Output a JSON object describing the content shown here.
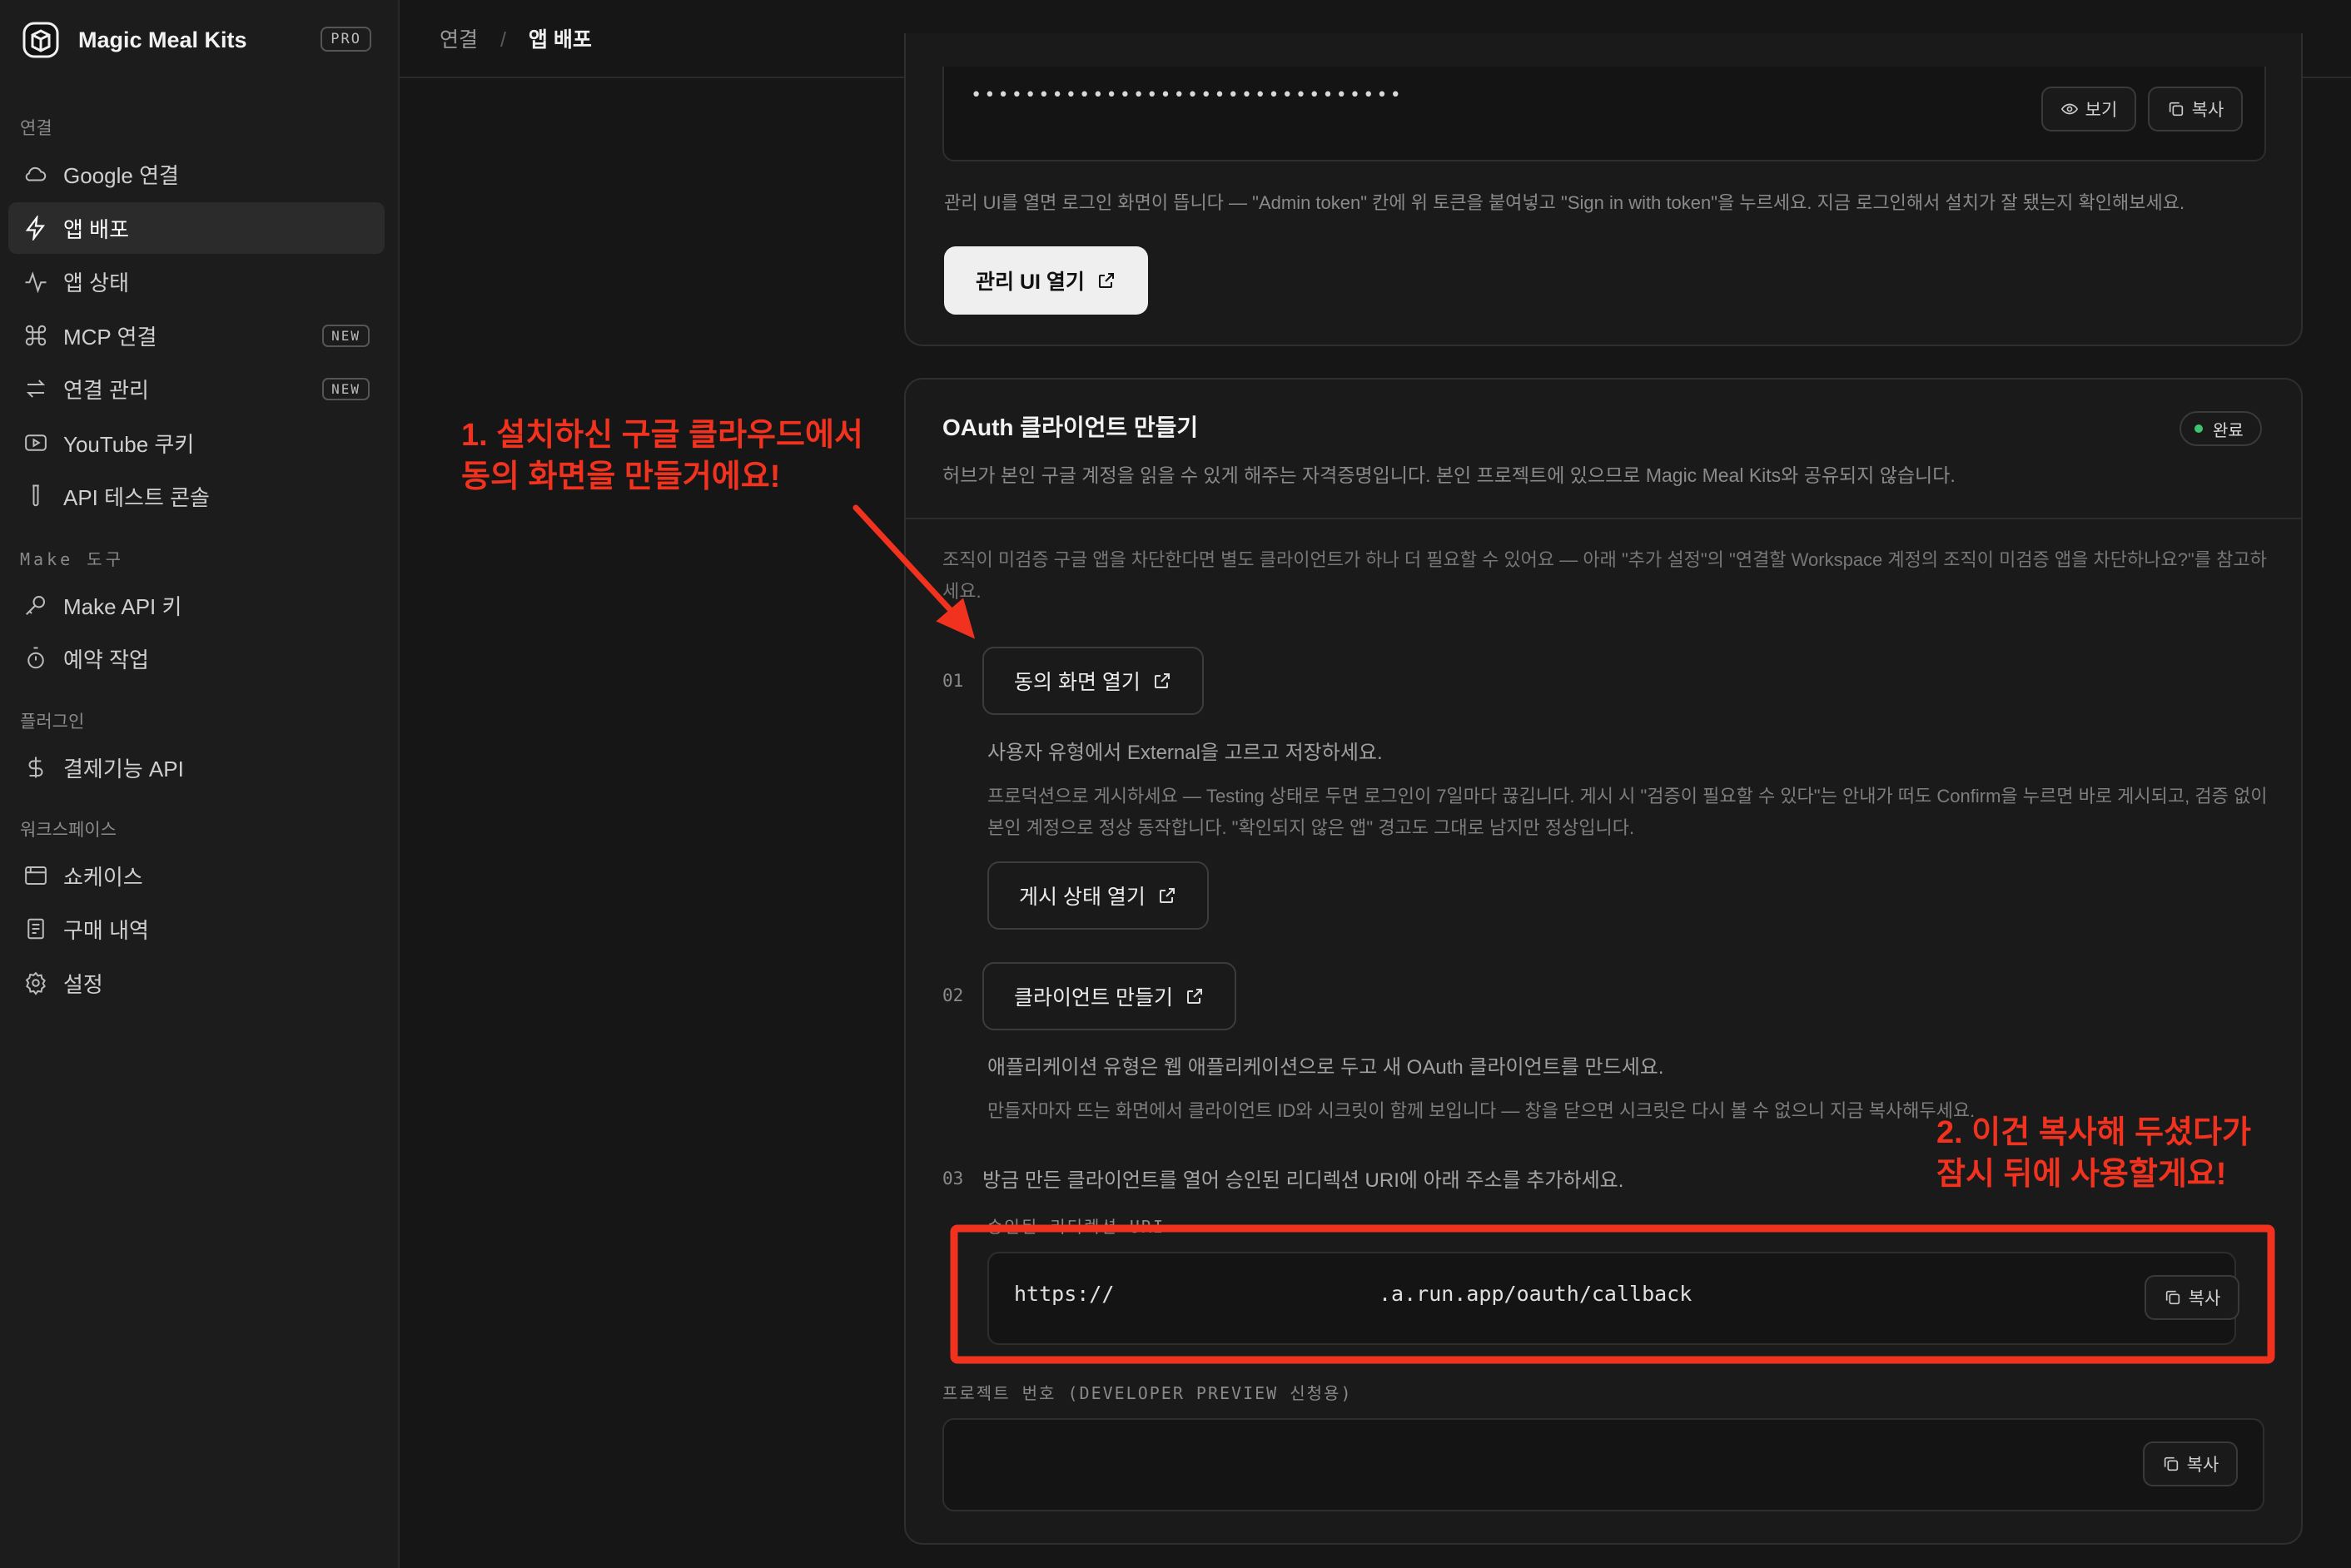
{
  "app": {
    "name": "Magic Meal Kits",
    "plan_badge": "PRO"
  },
  "sidebar": {
    "sections": [
      {
        "title": "연결",
        "items": [
          {
            "label": "Google 연결",
            "icon": "cloud-icon"
          },
          {
            "label": "앱 배포",
            "icon": "bolt-icon",
            "active": true
          },
          {
            "label": "앱 상태",
            "icon": "activity-icon"
          },
          {
            "label": "MCP 연결",
            "icon": "command-icon",
            "tag": "NEW"
          },
          {
            "label": "연결 관리",
            "icon": "swap-icon",
            "tag": "NEW"
          },
          {
            "label": "YouTube 쿠키",
            "icon": "youtube-icon"
          },
          {
            "label": "API 테스트 콘솔",
            "icon": "test-tube-icon"
          }
        ]
      },
      {
        "title": "Make 도구",
        "items": [
          {
            "label": "Make API 키",
            "icon": "key-icon"
          },
          {
            "label": "예약 작업",
            "icon": "timer-icon"
          }
        ]
      },
      {
        "title": "플러그인",
        "items": [
          {
            "label": "결제기능 API",
            "icon": "dollar-icon"
          }
        ]
      },
      {
        "title": "워크스페이스",
        "items": [
          {
            "label": "쇼케이스",
            "icon": "browser-icon"
          },
          {
            "label": "구매 내역",
            "icon": "receipt-icon"
          },
          {
            "label": "설정",
            "icon": "gear-icon"
          }
        ]
      }
    ]
  },
  "breadcrumb": {
    "parent": "연결",
    "separator": "/",
    "current": "앱 배포"
  },
  "admin_card": {
    "token_masked": "••••••••••••••••••••••••••••••••",
    "view_label": "보기",
    "copy_label": "복사",
    "help_text": "관리 UI를 열면 로그인 화면이 뜹니다 — \"Admin token\" 칸에 위 토큰을 붙여넣고 \"Sign in with token\"을 누르세요. 지금 로그인해서 설치가 잘 됐는지 확인해보세요.",
    "open_admin_label": "관리 UI 열기"
  },
  "oauth_card": {
    "title": "OAuth 클라이언트 만들기",
    "status_label": "완료",
    "status_color": "#3ec46d",
    "subtitle": "허브가 본인 구글 계정을 읽을 수 있게 해주는 자격증명입니다. 본인 프로젝트에 있으므로 Magic Meal Kits와 공유되지 않습니다.",
    "notice_line1": "조직이 미검증 구글 앱을 차단한다면 별도 클라이언트가 하나 더 필요할 수 있어요 — 아래 \"추가 설정\"의 \"연결할 Workspace 계정의 조직이 미검증 앱을 차단하나요?\"를 참고하",
    "notice_line2": "세요.",
    "step1": {
      "number": "01",
      "button": "동의 화면 열기",
      "text1": "사용자 유형에서 External을 고르고 저장하세요.",
      "text2_line1": "프로덕션으로 게시하세요 — Testing 상태로 두면 로그인이 7일마다 끊깁니다. 게시 시 \"검증이 필요할 수 있다\"는 안내가 떠도 Confirm을 누르면 바로 게시되고, 검증 없이",
      "text2_line2": "본인 계정으로 정상 동작합니다. \"확인되지 않은 앱\" 경고도 그대로 남지만 정상입니다.",
      "button2": "게시 상태 열기"
    },
    "step2": {
      "number": "02",
      "button": "클라이언트 만들기",
      "text1": "애플리케이션 유형은 웹 애플리케이션으로 두고 새 OAuth 클라이언트를 만드세요.",
      "text2": "만들자마자 뜨는 화면에서 클라이언트 ID와 시크릿이 함께 보입니다 — 창을 닫으면 시크릿은 다시 볼 수 없으니 지금 복사해두세요."
    },
    "step3": {
      "number": "03",
      "text": "방금 만든 클라이언트를 열어 승인된 리디렉션 URI에 아래 주소를 추가하세요.",
      "field_label": "승인된 리디렉션 URI",
      "uri_prefix": "https://",
      "uri_suffix": ".a.run.app/oauth/callback",
      "copy_label": "복사"
    },
    "project_number": {
      "label": "프로젝트 번호 (DEVELOPER PREVIEW 신청용)",
      "copy_label": "복사"
    }
  },
  "annotations": {
    "note1_line1": "1. 설치하신 구글 클라우드에서",
    "note1_line2": "동의 화면을 만들거에요!",
    "note2_line1": "2. 이건 복사해 두셨다가",
    "note2_line2": "잠시 뒤에 사용할게요!",
    "color": "#f0321e"
  }
}
